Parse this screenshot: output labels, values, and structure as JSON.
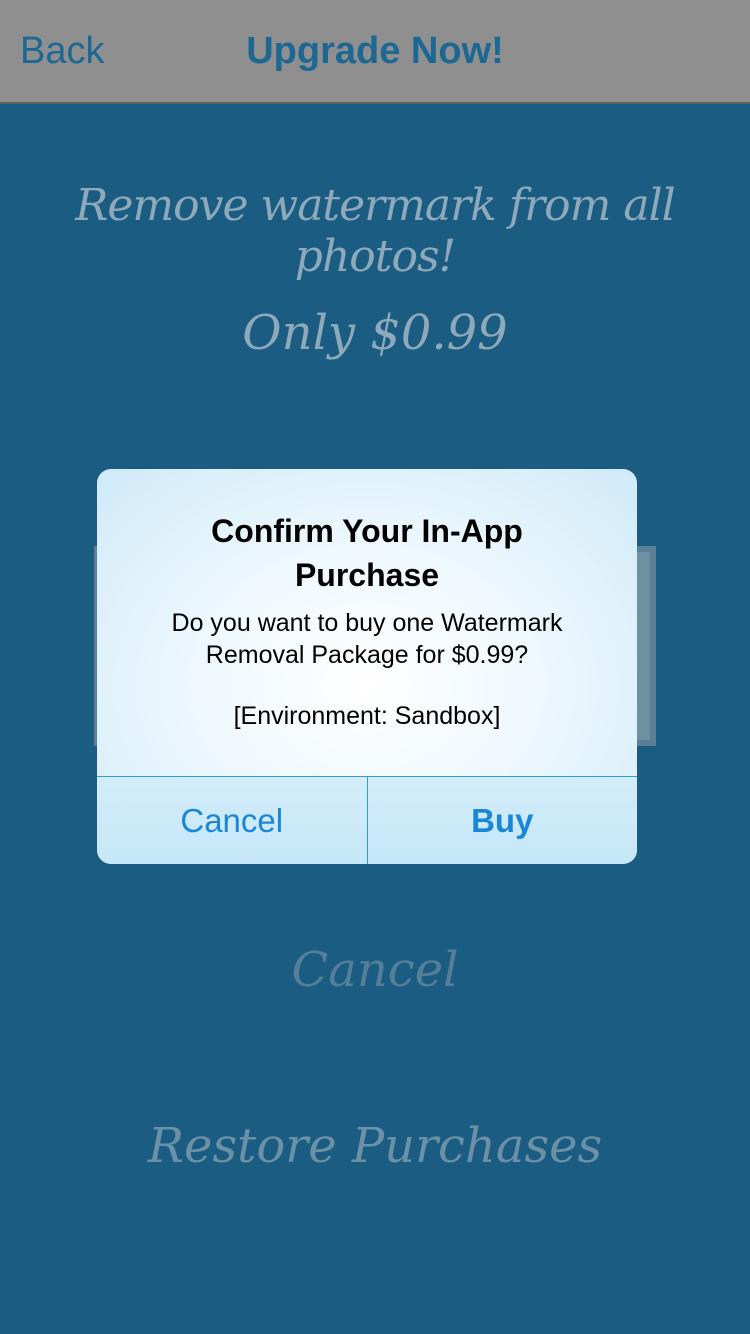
{
  "navbar": {
    "back_label": "Back",
    "title": "Upgrade Now!"
  },
  "content": {
    "headline": "Remove watermark from all photos!",
    "price": "Only $0.99",
    "cancel_label": "Cancel",
    "restore_label": "Restore Purchases"
  },
  "alert": {
    "title": "Confirm Your In-App Purchase",
    "message": "Do you want to buy one Watermark Removal Package for $0.99?",
    "environment": "[Environment: Sandbox]",
    "cancel_label": "Cancel",
    "buy_label": "Buy"
  },
  "colors": {
    "background": "#1b5c82",
    "accent": "#1a86d8"
  }
}
